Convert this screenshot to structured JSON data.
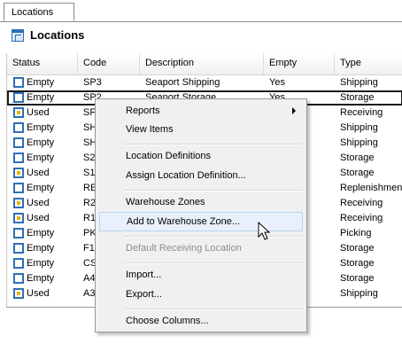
{
  "tab": {
    "label": "Locations"
  },
  "header": {
    "title": "Locations",
    "icon": "table-icon"
  },
  "columns": [
    "Status",
    "Code",
    "Description",
    "Empty",
    "Type"
  ],
  "rows": [
    {
      "status": "Empty",
      "code": "SP3",
      "description": "Seaport Shipping",
      "empty": "Yes",
      "type": "Shipping"
    },
    {
      "status": "Empty",
      "code": "SP2",
      "description": "Seaport Storage",
      "empty": "Yes",
      "type": "Storage"
    },
    {
      "status": "Used",
      "code": "SF",
      "description": "",
      "empty": "",
      "type": "Receiving"
    },
    {
      "status": "Empty",
      "code": "SH",
      "description": "",
      "empty": "",
      "type": "Shipping"
    },
    {
      "status": "Empty",
      "code": "SH",
      "description": "",
      "empty": "",
      "type": "Shipping"
    },
    {
      "status": "Empty",
      "code": "S2",
      "description": "",
      "empty": "",
      "type": "Storage"
    },
    {
      "status": "Used",
      "code": "S1",
      "description": "",
      "empty": "",
      "type": "Storage"
    },
    {
      "status": "Empty",
      "code": "RE",
      "description": "",
      "empty": "",
      "type": "Replenishment"
    },
    {
      "status": "Used",
      "code": "R2",
      "description": "",
      "empty": "",
      "type": "Receiving"
    },
    {
      "status": "Used",
      "code": "R1",
      "description": "",
      "empty": "",
      "type": "Receiving"
    },
    {
      "status": "Empty",
      "code": "PK",
      "description": "",
      "empty": "",
      "type": "Picking"
    },
    {
      "status": "Empty",
      "code": "F1",
      "description": "",
      "empty": "",
      "type": "Storage"
    },
    {
      "status": "Empty",
      "code": "CS",
      "description": "",
      "empty": "",
      "type": "Storage"
    },
    {
      "status": "Empty",
      "code": "A4",
      "description": "",
      "empty": "",
      "type": "Storage"
    },
    {
      "status": "Used",
      "code": "A3",
      "description": "",
      "empty": "",
      "type": "Shipping"
    }
  ],
  "context_menu": {
    "items": [
      {
        "label": "Reports",
        "submenu": true
      },
      {
        "label": "View Items"
      },
      {
        "label": "Location Definitions"
      },
      {
        "label": "Assign Location Definition..."
      },
      {
        "label": "Warehouse Zones"
      },
      {
        "label": "Add to Warehouse Zone..."
      },
      {
        "label": "Default Receiving Location"
      },
      {
        "label": "Import..."
      },
      {
        "label": "Export..."
      },
      {
        "label": "Choose Columns..."
      }
    ]
  },
  "colors": {
    "status_icon": "#2e6fb5",
    "used_fill": "#e6b400",
    "menu_bg": "#f0f0f0",
    "hover_bg": "#e8f1fb"
  }
}
